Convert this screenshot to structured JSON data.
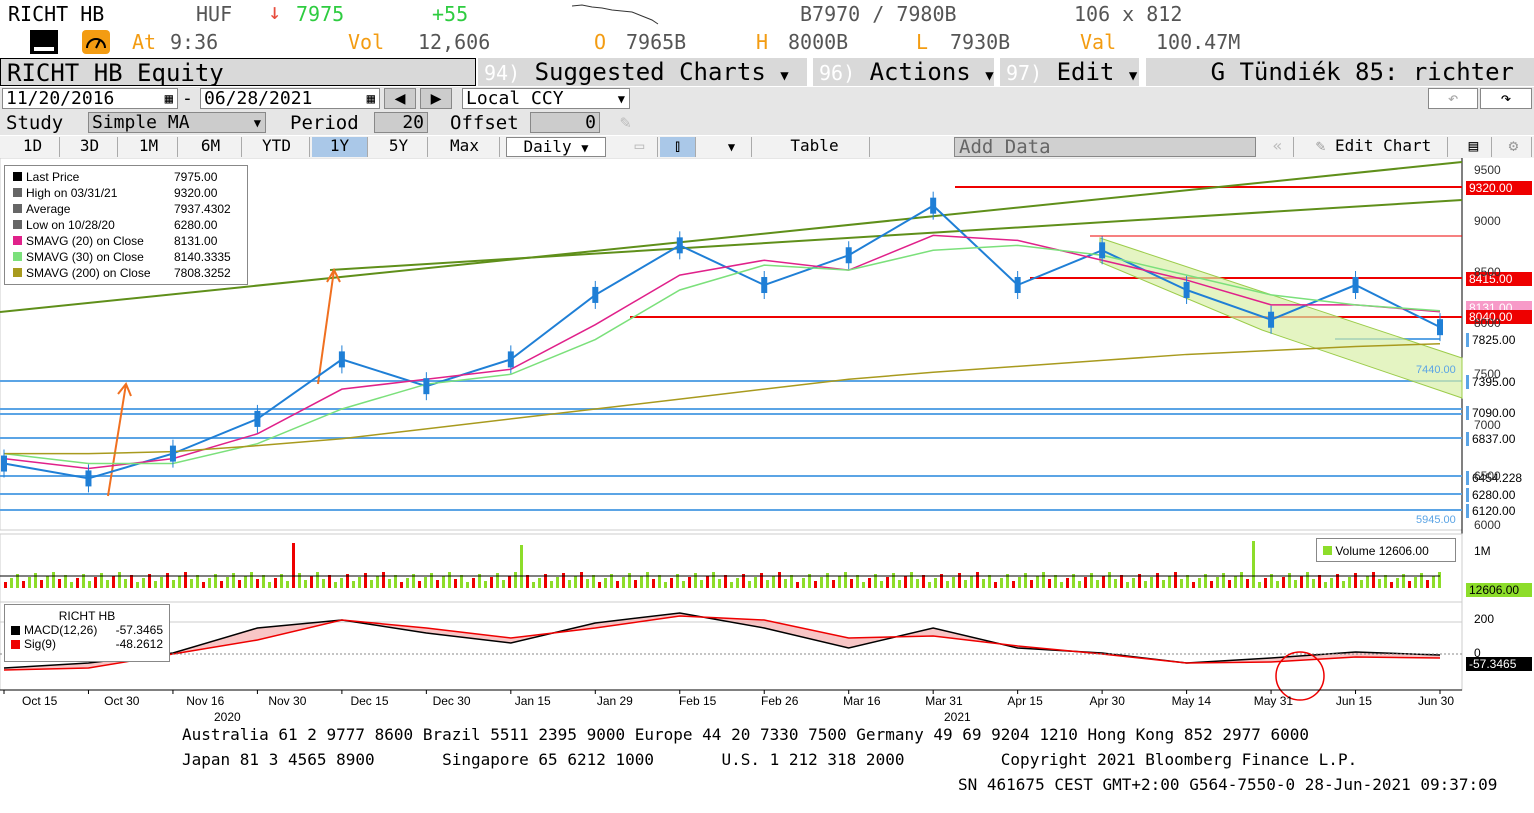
{
  "header": {
    "ticker": "RICHT HB",
    "currency": "HUF",
    "last_price": "7975",
    "change": "+55",
    "bid_ask": "B7970 / 7980B",
    "size": "106 x 812",
    "at_label": "At",
    "time": "9:36",
    "vol_label": "Vol",
    "volume": "12,606",
    "open_label": "O",
    "open": "7965B",
    "high_label": "H",
    "high": "8000B",
    "low_label": "L",
    "low": "7930B",
    "val_label": "Val",
    "value": "100.47M"
  },
  "menu": {
    "security": "RICHT HB Equity",
    "suggested_num": "94)",
    "suggested": "Suggested Charts",
    "actions_num": "96)",
    "actions": "Actions",
    "edit_num": "97)",
    "edit": "Edit",
    "user": "G Tündiék 85: richter"
  },
  "controls": {
    "start_date": "11/20/2016",
    "end_date": "06/28/2021",
    "date_sep": "-",
    "ccy": "Local CCY",
    "study_label": "Study",
    "study": "Simple MA",
    "period_label": "Period",
    "period": "20",
    "offset_label": "Offset",
    "offset": "0"
  },
  "tabs": {
    "ranges": [
      "1D",
      "3D",
      "1M",
      "6M",
      "YTD",
      "1Y",
      "5Y",
      "Max"
    ],
    "active": "1Y",
    "frequency": "Daily",
    "table": "Table",
    "add_data": "Add Data",
    "edit_chart": "Edit Chart"
  },
  "legend": {
    "rows": [
      {
        "label": "Last Price",
        "value": "7975.00",
        "color": "#000000"
      },
      {
        "label": "High on 03/31/21",
        "value": "9320.00",
        "color": "#666666"
      },
      {
        "label": "Average",
        "value": "7937.4302",
        "color": "#666666"
      },
      {
        "label": "Low on 10/28/20",
        "value": "6280.00",
        "color": "#666666"
      },
      {
        "label": "SMAVG (20)  on Close",
        "value": "8131.00",
        "color": "#e0218a"
      },
      {
        "label": "SMAVG (30)  on Close",
        "value": "8140.3335",
        "color": "#7be07b"
      },
      {
        "label": "SMAVG (200)  on Close",
        "value": "7808.3252",
        "color": "#a89a1e"
      }
    ]
  },
  "price_levels": {
    "tags": [
      "9320.00",
      "8415.00",
      "8131.00",
      "8040.00",
      "7825.00",
      "7395.00",
      "7090.00",
      "6837.00",
      "6454.228",
      "6280.00",
      "6120.00"
    ],
    "inline": [
      "7440.00",
      "5945.00"
    ],
    "axis_ticks": [
      "9500",
      "9000",
      "8500",
      "8000",
      "7500",
      "7000",
      "6500",
      "6000"
    ]
  },
  "volume_panel": {
    "label": "Volume",
    "value": "12606.00",
    "axis": "1M",
    "tag": "12606.00"
  },
  "macd_panel": {
    "title": "RICHT HB",
    "macd_label": "MACD(12,26)",
    "macd_value": "-57.3465",
    "sig_label": "Sig(9)",
    "sig_value": "-48.2612",
    "axis_ticks": [
      "200",
      "0"
    ],
    "tag": "-57.3465"
  },
  "x_axis": {
    "labels": [
      "Oct 15",
      "Oct 30",
      "Nov 16",
      "Nov 30",
      "Dec 15",
      "Dec 30",
      "Jan 15",
      "Jan 29",
      "Feb 15",
      "Feb 26",
      "Mar 16",
      "Mar 31",
      "Apr 15",
      "Apr 30",
      "May 14",
      "May 31",
      "Jun 15",
      "Jun 30"
    ],
    "years": [
      "2020",
      "2021"
    ]
  },
  "footer": {
    "line1": "Australia 61 2 9777 8600 Brazil 5511 2395 9000 Europe 44 20 7330 7500 Germany 49 69 9204 1210 Hong Kong 852 2977 6000",
    "line2": "Japan 81 3 4565 8900       Singapore 65 6212 1000       U.S. 1 212 318 2000          Copyright 2021 Bloomberg Finance L.P.",
    "line3": "SN 461675 CEST GMT+2:00 G564-7550-0 28-Jun-2021 09:37:09"
  },
  "chart_data": {
    "type": "line",
    "title": "RICHT HB Equity",
    "x_labels": [
      "Oct 15",
      "Oct 30",
      "Nov 16",
      "Nov 30",
      "Dec 15",
      "Dec 30",
      "Jan 15",
      "Jan 29",
      "Feb 15",
      "Feb 26",
      "Mar 16",
      "Mar 31",
      "Apr 15",
      "Apr 30",
      "May 14",
      "May 31",
      "Jun 15",
      "Jun 30"
    ],
    "ylim": [
      5950,
      9600
    ],
    "series": [
      {
        "name": "Last Price",
        "values": [
          6600,
          6450,
          6700,
          7050,
          7650,
          7380,
          7650,
          8300,
          8800,
          8400,
          8700,
          9200,
          8400,
          8750,
          8350,
          8050,
          8400,
          7975
        ]
      },
      {
        "name": "SMAVG (20)",
        "values": [
          6650,
          6550,
          6650,
          6900,
          7350,
          7450,
          7550,
          8000,
          8500,
          8650,
          8550,
          8900,
          8850,
          8650,
          8450,
          8200,
          8200,
          8131
        ]
      },
      {
        "name": "SMAVG (30)",
        "values": [
          6700,
          6600,
          6600,
          6800,
          7150,
          7400,
          7500,
          7850,
          8350,
          8600,
          8550,
          8750,
          8800,
          8700,
          8500,
          8300,
          8200,
          8140
        ]
      },
      {
        "name": "SMAVG (200)",
        "values": [
          6700,
          6700,
          6720,
          6780,
          6850,
          6950,
          7050,
          7150,
          7250,
          7350,
          7450,
          7520,
          7580,
          7640,
          7700,
          7740,
          7780,
          7808
        ]
      }
    ],
    "grid": false
  }
}
